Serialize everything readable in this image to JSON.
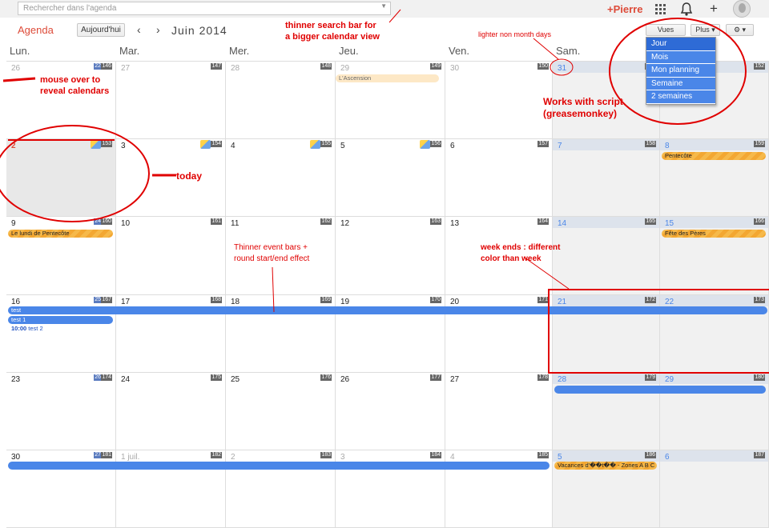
{
  "header": {
    "search_placeholder": "Rechercher dans l'agenda",
    "user": "+Pierre",
    "logo": "Agenda",
    "today_btn": "Aujourd'hui",
    "prev": "‹",
    "next": "›",
    "title": "Juin 2014",
    "views_btn": "Vues",
    "more_btn": "Plus ▾",
    "settings_btn": "⚙ ▾"
  },
  "views_menu": [
    "Jour",
    "Mois",
    "Mon planning",
    "Semaine",
    "2 semaines"
  ],
  "weekdays": [
    "Lun.",
    "Mar.",
    "Mer.",
    "Jeu.",
    "Ven.",
    "Sam.",
    "Dim."
  ],
  "weeks": [
    {
      "days": [
        "26",
        "27",
        "28",
        "29",
        "30",
        "31",
        "1"
      ],
      "wk": [
        "22",
        "146",
        "147",
        "148",
        "149",
        "150",
        "151",
        "152"
      ]
    },
    {
      "days": [
        "2",
        "3",
        "4",
        "5",
        "6",
        "7",
        "8"
      ],
      "wk": [
        "23",
        "153",
        "154",
        "155",
        "156",
        "157",
        "158",
        "159"
      ]
    },
    {
      "days": [
        "9",
        "10",
        "11",
        "12",
        "13",
        "14",
        "15"
      ],
      "wk": [
        "24",
        "160",
        "161",
        "162",
        "163",
        "164",
        "165",
        "166"
      ]
    },
    {
      "days": [
        "16",
        "17",
        "18",
        "19",
        "20",
        "21",
        "22"
      ],
      "wk": [
        "25",
        "167",
        "168",
        "169",
        "170",
        "171",
        "172",
        "173"
      ]
    },
    {
      "days": [
        "23",
        "24",
        "25",
        "26",
        "27",
        "28",
        "29"
      ],
      "wk": [
        "26",
        "174",
        "175",
        "176",
        "177",
        "178",
        "179",
        "180"
      ]
    },
    {
      "days": [
        "30",
        "1 juil.",
        "2",
        "3",
        "4",
        "5",
        "6"
      ],
      "wk": [
        "27",
        "181",
        "182",
        "183",
        "184",
        "185",
        "186",
        "187"
      ]
    }
  ],
  "events": {
    "ascension": "L'Ascension",
    "pentecote": "Pentecôte",
    "lundi_pentecote": "Le lundi de Pentecôte",
    "fete_peres": "Fête des Pères",
    "test": "test",
    "test1": "test 1",
    "test2_time": "10:00",
    "test2": "test 2",
    "vacances": "Vacances d'��t�� - Zones A B C"
  },
  "annotations": {
    "search": "thinner search bar for\na bigger calendar view",
    "mouse": "mouse over to\nreveal calendars",
    "lighter": "lighter non month days",
    "script": "Works with script\n(greasemonkey)",
    "today": "today",
    "thinner": "Thinner event bars +\nround start/end effect",
    "weekends": "week ends : different\ncolor than week"
  },
  "colors": {
    "accent": "#dd4b39",
    "event_blue": "#4a86e8",
    "event_orange": "#f6b94a",
    "annotation": "#e00000"
  }
}
